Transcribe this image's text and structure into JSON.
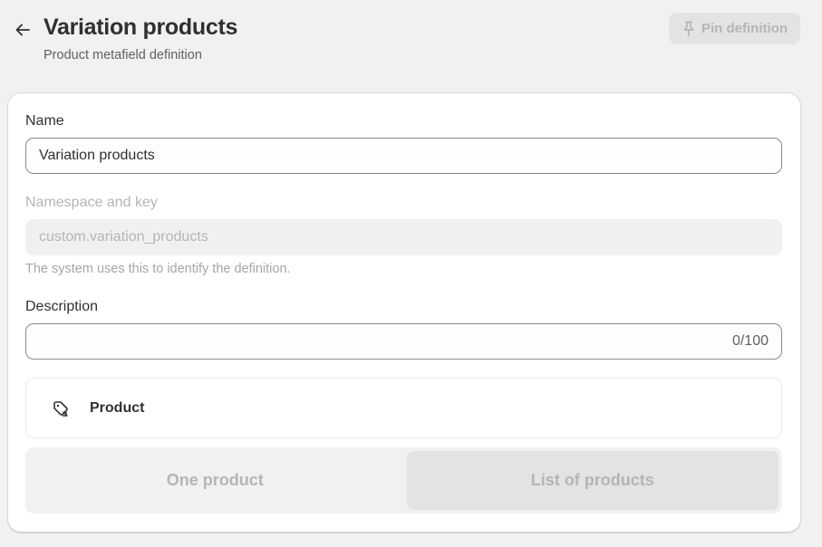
{
  "header": {
    "title": "Variation products",
    "subtitle": "Product metafield definition",
    "pin_label": "Pin definition"
  },
  "form": {
    "name_label": "Name",
    "name_value": "Variation products",
    "namespace_label": "Namespace and key",
    "namespace_value": "custom.variation_products",
    "namespace_help": "The system uses this to identify the definition.",
    "description_label": "Description",
    "description_counter": "0/100"
  },
  "type": {
    "label": "Product",
    "icon": "product-tag-icon"
  },
  "cardinality": {
    "options": [
      "One product",
      "List of products"
    ],
    "selected": "List of products"
  },
  "colors": {
    "background": "#f1f1f1",
    "card": "#ffffff",
    "text": "#303030",
    "muted": "#b5b5b5",
    "disabled_fill": "#e3e3e3"
  }
}
